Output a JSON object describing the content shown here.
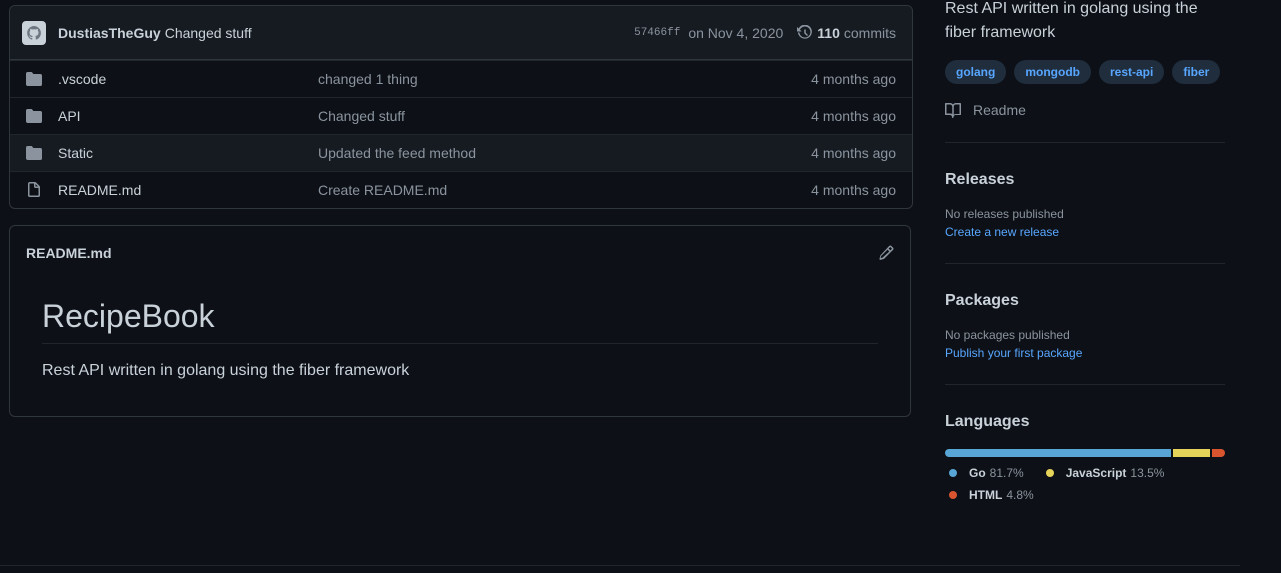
{
  "latest_commit": {
    "author": "DustiasTheGuy",
    "message": "Changed stuff",
    "sha": "57466ff",
    "date": "on Nov 4, 2020",
    "count": "110",
    "count_label": "commits"
  },
  "files": [
    {
      "type": "folder",
      "name": ".vscode",
      "message": "changed 1 thing",
      "age": "4 months ago"
    },
    {
      "type": "folder",
      "name": "API",
      "message": "Changed stuff",
      "age": "4 months ago"
    },
    {
      "type": "folder",
      "name": "Static",
      "message": "Updated the feed method",
      "age": "4 months ago"
    },
    {
      "type": "file",
      "name": "README.md",
      "message": "Create README.md",
      "age": "4 months ago"
    }
  ],
  "readme": {
    "filename": "README.md",
    "heading": "RecipeBook",
    "body": "Rest API written in golang using the fiber framework"
  },
  "about": {
    "description": "Rest API written in golang using the fiber framework",
    "topics": [
      "golang",
      "mongodb",
      "rest-api",
      "fiber"
    ],
    "readme_label": "Readme"
  },
  "releases": {
    "title": "Releases",
    "status": "No releases published",
    "link": "Create a new release"
  },
  "packages": {
    "title": "Packages",
    "status": "No packages published",
    "link": "Publish your first package"
  },
  "languages": {
    "title": "Languages",
    "items": [
      {
        "name": "Go",
        "percent": "81.7%",
        "value": 81.7,
        "color": "#58a6d6"
      },
      {
        "name": "JavaScript",
        "percent": "13.5%",
        "value": 13.5,
        "color": "#e6d35a"
      },
      {
        "name": "HTML",
        "percent": "4.8%",
        "value": 4.8,
        "color": "#d9552f"
      }
    ]
  },
  "colors": {
    "background": "#0d1117",
    "border": "#30363d",
    "link": "#58a6ff",
    "muted": "#8b949e"
  }
}
